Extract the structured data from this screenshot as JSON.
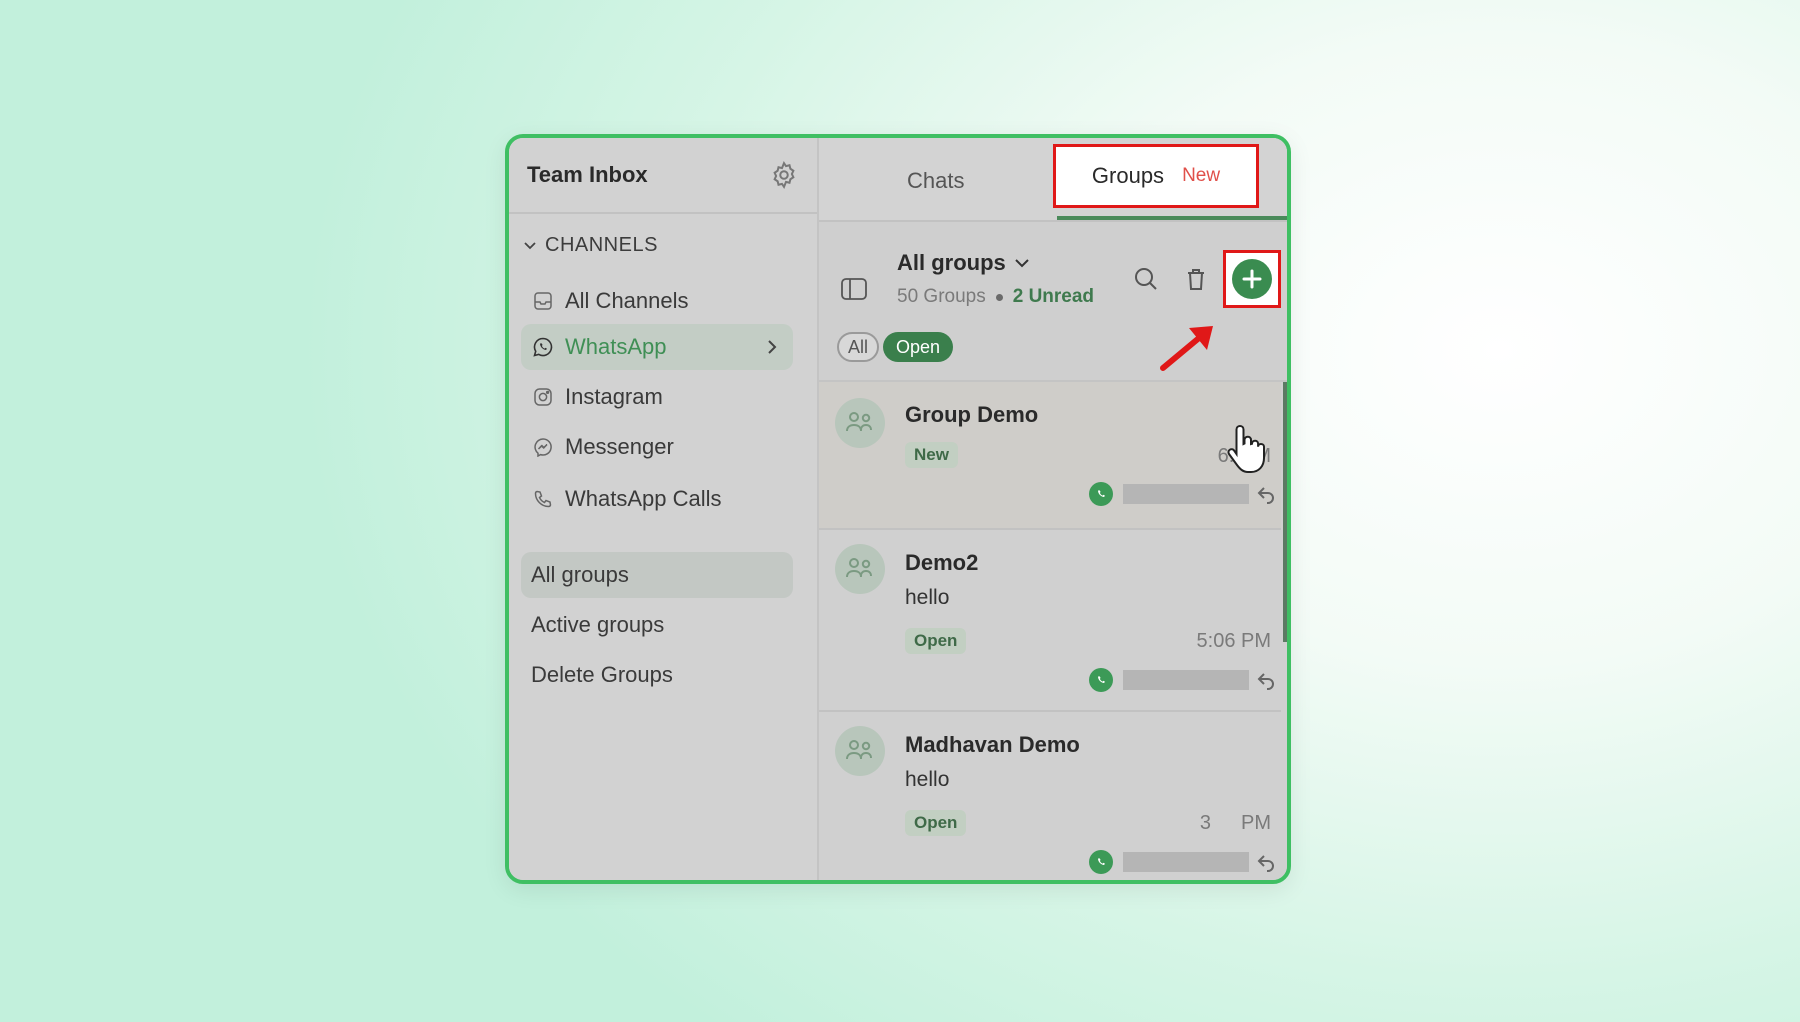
{
  "sidebar": {
    "title": "Team Inbox",
    "channels_heading": "CHANNELS",
    "channels": [
      {
        "label": "All Channels",
        "icon": "inbox-icon"
      },
      {
        "label": "WhatsApp",
        "icon": "whatsapp-icon",
        "active": true
      },
      {
        "label": "Instagram",
        "icon": "instagram-icon"
      },
      {
        "label": "Messenger",
        "icon": "messenger-icon"
      },
      {
        "label": "WhatsApp Calls",
        "icon": "phone-icon"
      }
    ],
    "groups_nav": [
      {
        "label": "All groups",
        "active": true
      },
      {
        "label": "Active groups"
      },
      {
        "label": "Delete Groups"
      }
    ]
  },
  "tabs": {
    "chats": "Chats",
    "groups": "Groups",
    "groups_badge": "New"
  },
  "toolbar": {
    "title": "All groups",
    "group_count": "50 Groups",
    "unread": "2 Unread",
    "filter_all": "All",
    "filter_open": "Open"
  },
  "groups": [
    {
      "name": "Group Demo",
      "message": "",
      "status": "New",
      "time": "6:  M"
    },
    {
      "name": "Demo2",
      "message": "hello",
      "status": "Open",
      "time": "5:06 PM"
    },
    {
      "name": "Madhavan Demo",
      "message": "hello",
      "status": "Open",
      "time": "3  PM"
    }
  ],
  "colors": {
    "accent_green": "#3a8c50",
    "highlight_red": "#e01818",
    "frame_green": "#3fbf63"
  }
}
